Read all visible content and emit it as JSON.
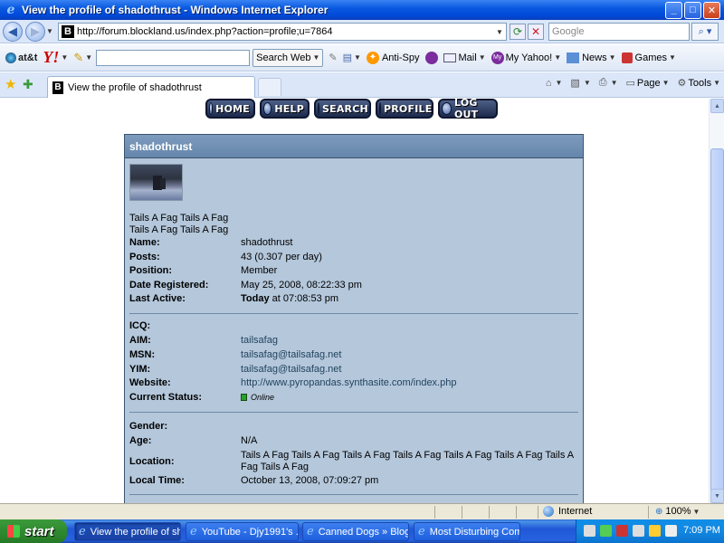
{
  "window": {
    "title": "View the profile of shadothrust - Windows Internet Explorer"
  },
  "address": {
    "url": "http://forum.blockland.us/index.php?action=profile;u=7864",
    "search_placeholder": "Google"
  },
  "toolbar": {
    "att": "at&t",
    "yahoo": "Y!",
    "search_web": "Search Web",
    "antispy": "Anti-Spy",
    "mail": "Mail",
    "my_yahoo": "My Yahoo!",
    "news": "News",
    "games": "Games"
  },
  "tab": {
    "label": "View the profile of shadothrust"
  },
  "commands": {
    "page": "Page",
    "tools": "Tools"
  },
  "forum_menu": {
    "home": "HOME",
    "help": "HELP",
    "search": "SEARCH",
    "profile": "PROFILE",
    "logout": "LOG OUT"
  },
  "profile": {
    "username_header": "shadothrust",
    "signature": [
      "Tails A Fag Tails A Fag",
      "Tails A Fag Tails A Fag"
    ],
    "basic": [
      {
        "label": "Name:",
        "value": "shadothrust"
      },
      {
        "label": "Posts:",
        "value": "43 (0.307 per day)"
      },
      {
        "label": "Position:",
        "value": "Member"
      },
      {
        "label": "Date Registered:",
        "value": "May 25, 2008, 08:22:33 pm"
      },
      {
        "label": "Last Active:",
        "value_bold": "Today",
        "value": " at 07:08:53 pm"
      }
    ],
    "contact": [
      {
        "label": "ICQ:",
        "value": ""
      },
      {
        "label": "AIM:",
        "value": "tailsafag"
      },
      {
        "label": "MSN:",
        "value": "tailsafag@tailsafag.net"
      },
      {
        "label": "YIM:",
        "value": "tailsafag@tailsafag.net"
      },
      {
        "label": "Website:",
        "value": "http://www.pyropandas.synthasite.com/index.php"
      },
      {
        "label": "Current Status:",
        "value": "Online"
      }
    ],
    "personal": [
      {
        "label": "Gender:",
        "value": ""
      },
      {
        "label": "Age:",
        "value": "N/A"
      },
      {
        "label": "Location:",
        "value": "Tails A Fag Tails A Fag Tails A Fag Tails A Fag Tails A Fag Tails A Fag Tails A Fag Tails A Fag"
      },
      {
        "label": "Local Time:",
        "value": "October 13, 2008, 07:09:27 pm"
      }
    ]
  },
  "statusbar": {
    "zone": "Internet",
    "zoom": "100%"
  },
  "taskbar": {
    "start": "start",
    "tasks": [
      "View the profile of sh...",
      "YouTube - Djy1991's ...",
      "Canned Dogs » Blog ...",
      "Most Disturbing Com..."
    ],
    "clock": "7:09 PM"
  }
}
